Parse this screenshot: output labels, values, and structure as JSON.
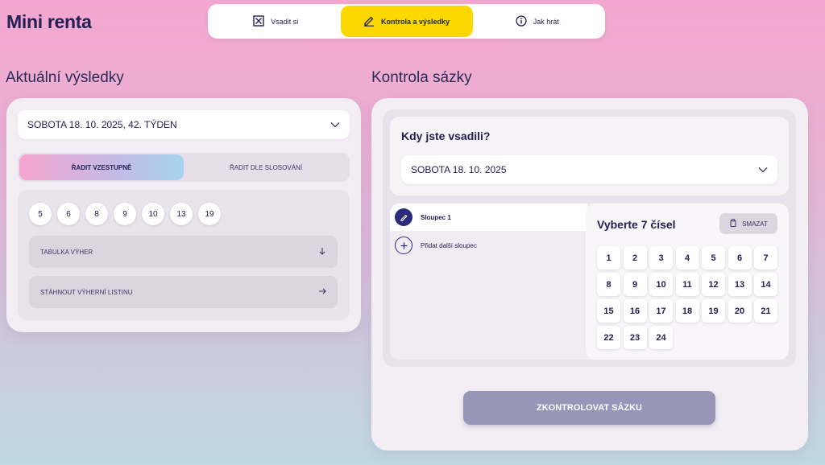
{
  "brand": "Mini renta",
  "nav": {
    "tabs": [
      {
        "label": "Vsadit si",
        "icon": "ticket-x-icon"
      },
      {
        "label": "Kontrola a výsledky",
        "icon": "pencil-icon",
        "active": true
      },
      {
        "label": "Jak hrát",
        "icon": "info-icon"
      }
    ]
  },
  "results": {
    "title": "Aktuální výsledky",
    "draw_select": "SOBOTA 18. 10. 2025, 42. TÝDEN",
    "sort_options": [
      "ŘADIT VZESTUPNĚ",
      "ŘADIT DLE SLOSOVÁNÍ"
    ],
    "numbers": [
      "5",
      "6",
      "8",
      "9",
      "10",
      "13",
      "19"
    ],
    "prize_table": "TABULKA VÝHER",
    "download_list": "STÁHNOUT VÝHERNÍ LISTINU"
  },
  "check": {
    "title": "Kontrola sázky",
    "when_title": "Kdy jste vsadili?",
    "date_select": "SOBOTA 18. 10. 2025",
    "column_label": "Sloupec 1",
    "add_column": "Přidat další sloupec",
    "picker_title": "Vyberte 7 čísel",
    "clear_label": "SMAZAT",
    "numbers": [
      "1",
      "2",
      "3",
      "4",
      "5",
      "6",
      "7",
      "8",
      "9",
      "10",
      "11",
      "12",
      "13",
      "14",
      "15",
      "16",
      "17",
      "18",
      "19",
      "20",
      "21",
      "22",
      "23",
      "24"
    ],
    "submit": "ZKONTROLOVAT SÁZKU"
  },
  "colors": {
    "accent_yellow": "#fbd800",
    "navy": "#232053",
    "submit_bg": "#9596b8"
  }
}
